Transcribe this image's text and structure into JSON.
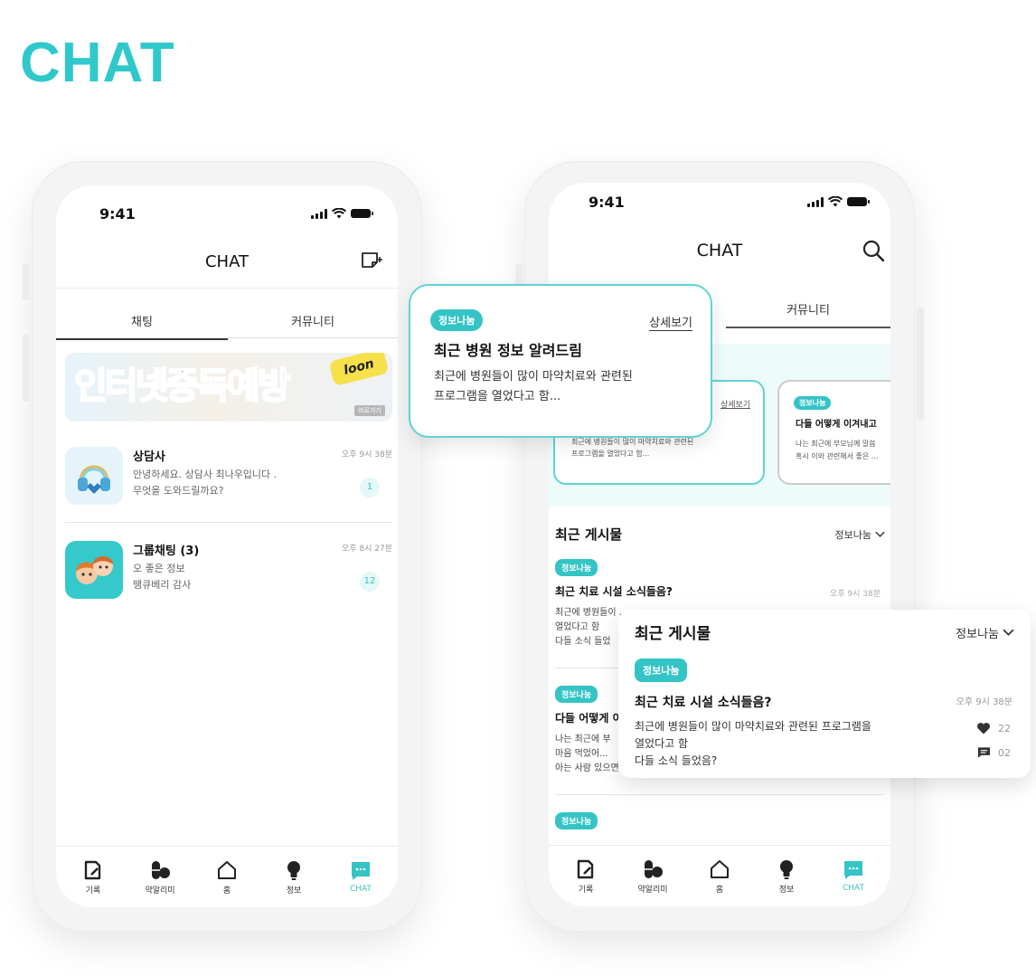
{
  "page": {
    "heading": "CHAT"
  },
  "colors": {
    "accent": "#35c4c6",
    "heading": "#2fc9cc",
    "text": "#111111",
    "muted": "#999999"
  },
  "left_phone": {
    "status": {
      "time": "9:41"
    },
    "header": {
      "title": "CHAT",
      "action_icon": "compose-icon"
    },
    "tabs": [
      {
        "label": "채팅",
        "active": true
      },
      {
        "label": "커뮤니티",
        "active": false
      }
    ],
    "banner": {
      "text_part1": "인터넷",
      "text_part2": "중독예방",
      "burst": "loon",
      "more": "바로가기"
    },
    "chats": [
      {
        "name": "상담사",
        "message_line1": "안녕하세요. 상담사 최나우입니다 .",
        "message_line2": "무엇을 도와드릴까요?",
        "time": "오후 9시 38분",
        "unread": "1",
        "avatar_icon": "headset-icon"
      },
      {
        "name": "그룹채팅 (3)",
        "message_line1": "오 좋은 정보",
        "message_line2": "땡큐베리 감사",
        "time": "오후 8시 27분",
        "unread": "12",
        "avatar_icon": "group-avatar-icon"
      }
    ]
  },
  "right_phone": {
    "status": {
      "time": "9:41"
    },
    "header": {
      "title": "CHAT",
      "action_icon": "search-icon"
    },
    "tabs": [
      {
        "label": "커뮤니티",
        "active": true
      }
    ],
    "cards": [
      {
        "more": "상세보기",
        "body_line1": "최근에 병원들이 많이 마약치료와 관련된",
        "body_line2": "프로그램을 열었다고 함..."
      },
      {
        "chip": "정보나눔",
        "title": "다들 어떻게 이겨내고",
        "body_line1": "나는 최근에 부모님께 말씀",
        "body_line2": "혹시 이와 관련해서 좋은 ..."
      }
    ],
    "recent": {
      "title": "최근 게시물",
      "filter": "정보나눔"
    },
    "posts": [
      {
        "chip": "정보나눔",
        "title": "최근 치료 시설 소식들음?",
        "time": "오후 9시 38분",
        "body_line1": "최근에 병원들이 ...",
        "body_line2": "열었다고 함",
        "body_line3": "다들 소식 들었"
      },
      {
        "chip": "정보나눔",
        "title": "다들 어떻게 이",
        "body_line1": "나는 최근에 부",
        "body_line2": "마음 먹었어...",
        "body_line3": "아는 사람 있으면"
      },
      {
        "chip": "정보나눔"
      }
    ]
  },
  "bottom_nav": [
    {
      "label": "기록",
      "icon": "note-edit-icon",
      "active": false
    },
    {
      "label": "약알리미",
      "icon": "pill-icon",
      "active": false
    },
    {
      "label": "홈",
      "icon": "home-icon",
      "active": false
    },
    {
      "label": "정보",
      "icon": "lightbulb-icon",
      "active": false
    },
    {
      "label": "CHAT",
      "icon": "chat-bubble-icon",
      "active": true
    }
  ],
  "popup_info": {
    "chip": "정보나눔",
    "more": "상세보기",
    "title": "최근 병원 정보 알려드림",
    "body_line1": "최근에 병원들이 많이 마약치료와 관련된",
    "body_line2": "프로그램을 열었다고 함..."
  },
  "popup_posts": {
    "section_title": "최근 게시물",
    "filter": "정보나눔",
    "chip": "정보나눔",
    "title": "최근 치료 시설 소식들음?",
    "time": "오후 9시 38분",
    "body_line1": "최근에 병원들이 많이 마약치료와 관련된 프로그램을",
    "body_line2": "열었다고 함",
    "body_line3": "다들 소식 들었음?",
    "likes": "22",
    "comments": "02"
  }
}
